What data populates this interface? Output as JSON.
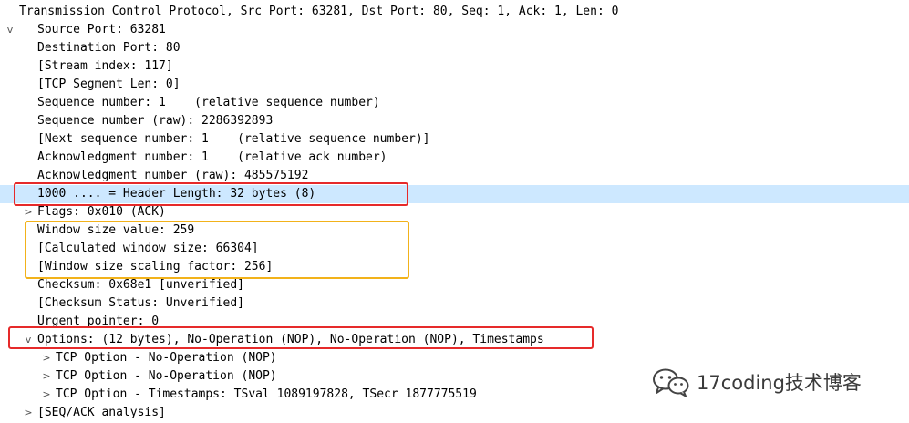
{
  "tree": {
    "header": {
      "toggle": "v",
      "text": "Transmission Control Protocol, Src Port: 63281, Dst Port: 80, Seq: 1, Ack: 1, Len: 0"
    },
    "rows": [
      {
        "text": "Source Port: 63281"
      },
      {
        "text": "Destination Port: 80"
      },
      {
        "text": "[Stream index: 117]"
      },
      {
        "text": "[TCP Segment Len: 0]"
      },
      {
        "text": "Sequence number: 1    (relative sequence number)"
      },
      {
        "text": "Sequence number (raw): 2286392893"
      },
      {
        "text": "[Next sequence number: 1    (relative sequence number)]"
      },
      {
        "text": "Acknowledgment number: 1    (relative ack number)"
      },
      {
        "text": "Acknowledgment number (raw): 485575192"
      },
      {
        "text": "1000 .... = Header Length: 32 bytes (8)",
        "selected": true
      },
      {
        "text": "Flags: 0x010 (ACK)",
        "toggle": ">"
      },
      {
        "text": "Window size value: 259"
      },
      {
        "text": "[Calculated window size: 66304]"
      },
      {
        "text": "[Window size scaling factor: 256]"
      },
      {
        "text": "Checksum: 0x68e1 [unverified]"
      },
      {
        "text": "[Checksum Status: Unverified]"
      },
      {
        "text": "Urgent pointer: 0"
      },
      {
        "text": "Options: (12 bytes), No-Operation (NOP), No-Operation (NOP), Timestamps",
        "toggle": "v"
      },
      {
        "text": "TCP Option - No-Operation (NOP)",
        "toggle": ">",
        "indent": 2
      },
      {
        "text": "TCP Option - No-Operation (NOP)",
        "toggle": ">",
        "indent": 2
      },
      {
        "text": "TCP Option - Timestamps: TSval 1089197828, TSecr 1877775519",
        "toggle": ">",
        "indent": 2
      },
      {
        "text": "[SEQ/ACK analysis]",
        "toggle": ">"
      }
    ]
  },
  "highlights": {
    "red": "#e62a2a",
    "orange": "#f2b21a",
    "selection": "#cde8ff"
  },
  "watermark": {
    "icon": "wechat-icon",
    "text": "17coding技术博客"
  }
}
